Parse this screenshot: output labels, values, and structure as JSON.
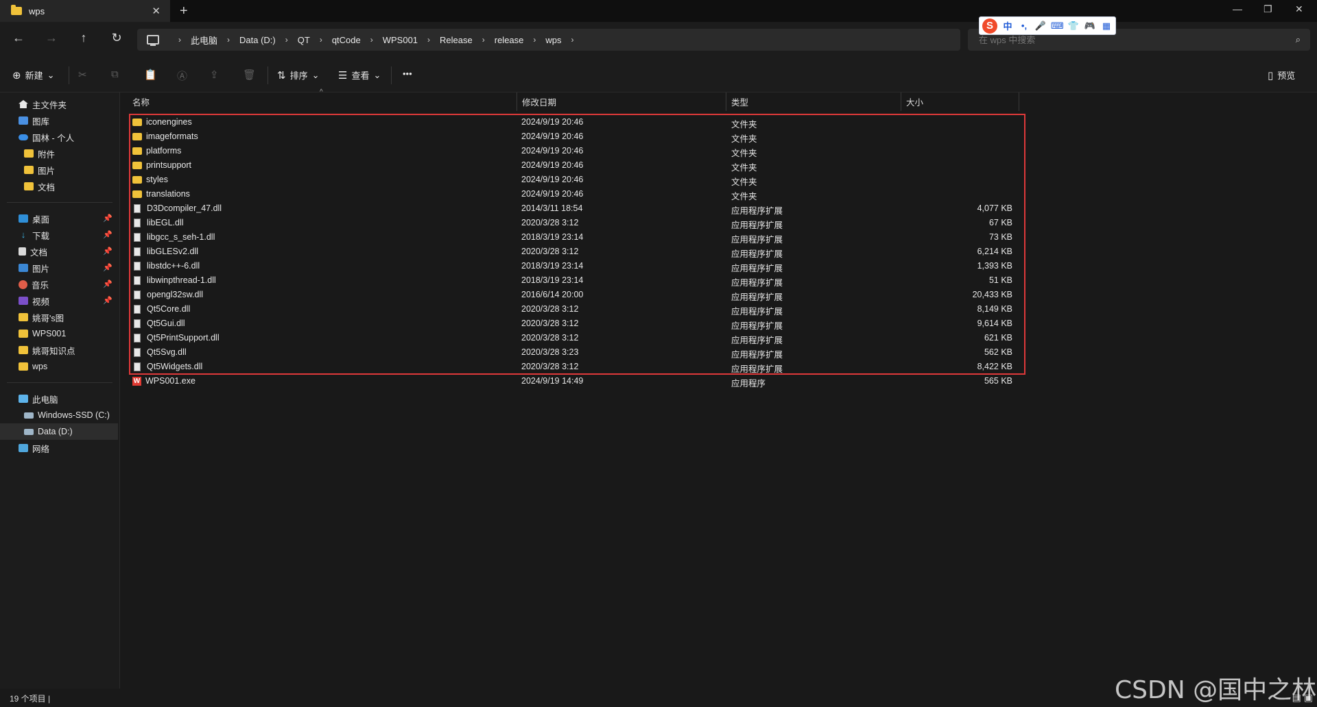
{
  "window": {
    "tab_title": "wps",
    "tab_close": "✕",
    "new_tab": "+",
    "minimize": "—",
    "restore": "❐",
    "close": "✕"
  },
  "nav": {
    "back": "←",
    "forward": "→",
    "up": "↑",
    "refresh": "↻",
    "breadcrumb": [
      "此电脑",
      "Data (D:)",
      "QT",
      "qtCode",
      "WPS001",
      "Release",
      "release",
      "wps"
    ],
    "search_placeholder": "在 wps 中搜索"
  },
  "ime": {
    "logo": "S",
    "items": [
      "中",
      "•,",
      "🎤",
      "⌨",
      "👕",
      "🎮",
      "▦"
    ]
  },
  "toolbar": {
    "new_label": "新建",
    "sort_label": "排序",
    "view_label": "查看",
    "more_label": "•••",
    "preview_label": "预览"
  },
  "sidebar": {
    "quick": [
      {
        "label": "主文件夹",
        "icon": "home-icon"
      },
      {
        "label": "图库",
        "icon": "gallery-icon"
      },
      {
        "label": "国林 - 个人",
        "icon": "onedrive-icon"
      },
      {
        "label": "附件",
        "icon": "folder-icon"
      },
      {
        "label": "图片",
        "icon": "folder-icon"
      },
      {
        "label": "文档",
        "icon": "folder-icon"
      }
    ],
    "pinned": [
      {
        "label": "桌面",
        "icon": "desktop-icon",
        "pin": "📌"
      },
      {
        "label": "下载",
        "icon": "download-icon",
        "pin": "📌"
      },
      {
        "label": "文档",
        "icon": "document-icon",
        "pin": "📌"
      },
      {
        "label": "图片",
        "icon": "pictures-icon",
        "pin": "📌"
      },
      {
        "label": "音乐",
        "icon": "music-icon",
        "pin": "📌"
      },
      {
        "label": "视频",
        "icon": "video-icon",
        "pin": "📌"
      },
      {
        "label": "姚哥's图",
        "icon": "folder-icon"
      },
      {
        "label": "WPS001",
        "icon": "folder-icon"
      },
      {
        "label": "姚哥知识点",
        "icon": "folder-icon"
      },
      {
        "label": "wps",
        "icon": "folder-icon"
      }
    ],
    "devices": [
      {
        "label": "此电脑",
        "icon": "pc-icon"
      },
      {
        "label": "Windows-SSD (C:)",
        "icon": "drive-icon"
      },
      {
        "label": "Data (D:)",
        "icon": "drive-icon",
        "selected": true
      },
      {
        "label": "网络",
        "icon": "network-icon"
      }
    ]
  },
  "columns": {
    "name": "名称",
    "date": "修改日期",
    "type": "类型",
    "size": "大小",
    "sort_caret": "^"
  },
  "files": [
    {
      "name": "iconengines",
      "date": "2024/9/19 20:46",
      "type": "文件夹",
      "size": "",
      "kind": "folder"
    },
    {
      "name": "imageformats",
      "date": "2024/9/19 20:46",
      "type": "文件夹",
      "size": "",
      "kind": "folder"
    },
    {
      "name": "platforms",
      "date": "2024/9/19 20:46",
      "type": "文件夹",
      "size": "",
      "kind": "folder"
    },
    {
      "name": "printsupport",
      "date": "2024/9/19 20:46",
      "type": "文件夹",
      "size": "",
      "kind": "folder"
    },
    {
      "name": "styles",
      "date": "2024/9/19 20:46",
      "type": "文件夹",
      "size": "",
      "kind": "folder"
    },
    {
      "name": "translations",
      "date": "2024/9/19 20:46",
      "type": "文件夹",
      "size": "",
      "kind": "folder"
    },
    {
      "name": "D3Dcompiler_47.dll",
      "date": "2014/3/11 18:54",
      "type": "应用程序扩展",
      "size": "4,077 KB",
      "kind": "dll"
    },
    {
      "name": "libEGL.dll",
      "date": "2020/3/28 3:12",
      "type": "应用程序扩展",
      "size": "67 KB",
      "kind": "dll"
    },
    {
      "name": "libgcc_s_seh-1.dll",
      "date": "2018/3/19 23:14",
      "type": "应用程序扩展",
      "size": "73 KB",
      "kind": "dll"
    },
    {
      "name": "libGLESv2.dll",
      "date": "2020/3/28 3:12",
      "type": "应用程序扩展",
      "size": "6,214 KB",
      "kind": "dll"
    },
    {
      "name": "libstdc++-6.dll",
      "date": "2018/3/19 23:14",
      "type": "应用程序扩展",
      "size": "1,393 KB",
      "kind": "dll"
    },
    {
      "name": "libwinpthread-1.dll",
      "date": "2018/3/19 23:14",
      "type": "应用程序扩展",
      "size": "51 KB",
      "kind": "dll"
    },
    {
      "name": "opengl32sw.dll",
      "date": "2016/6/14 20:00",
      "type": "应用程序扩展",
      "size": "20,433 KB",
      "kind": "dll"
    },
    {
      "name": "Qt5Core.dll",
      "date": "2020/3/28 3:12",
      "type": "应用程序扩展",
      "size": "8,149 KB",
      "kind": "dll"
    },
    {
      "name": "Qt5Gui.dll",
      "date": "2020/3/28 3:12",
      "type": "应用程序扩展",
      "size": "9,614 KB",
      "kind": "dll"
    },
    {
      "name": "Qt5PrintSupport.dll",
      "date": "2020/3/28 3:12",
      "type": "应用程序扩展",
      "size": "621 KB",
      "kind": "dll"
    },
    {
      "name": "Qt5Svg.dll",
      "date": "2020/3/28 3:23",
      "type": "应用程序扩展",
      "size": "562 KB",
      "kind": "dll"
    },
    {
      "name": "Qt5Widgets.dll",
      "date": "2020/3/28 3:12",
      "type": "应用程序扩展",
      "size": "8,422 KB",
      "kind": "dll"
    },
    {
      "name": "WPS001.exe",
      "date": "2024/9/19 14:49",
      "type": "应用程序",
      "size": "565 KB",
      "kind": "exe"
    }
  ],
  "status": {
    "count": "19 个项目  |"
  },
  "watermark": "CSDN @国中之林",
  "colors": {
    "highlight": "#e0393a",
    "folder": "#f0c23a",
    "background": "#191919"
  }
}
